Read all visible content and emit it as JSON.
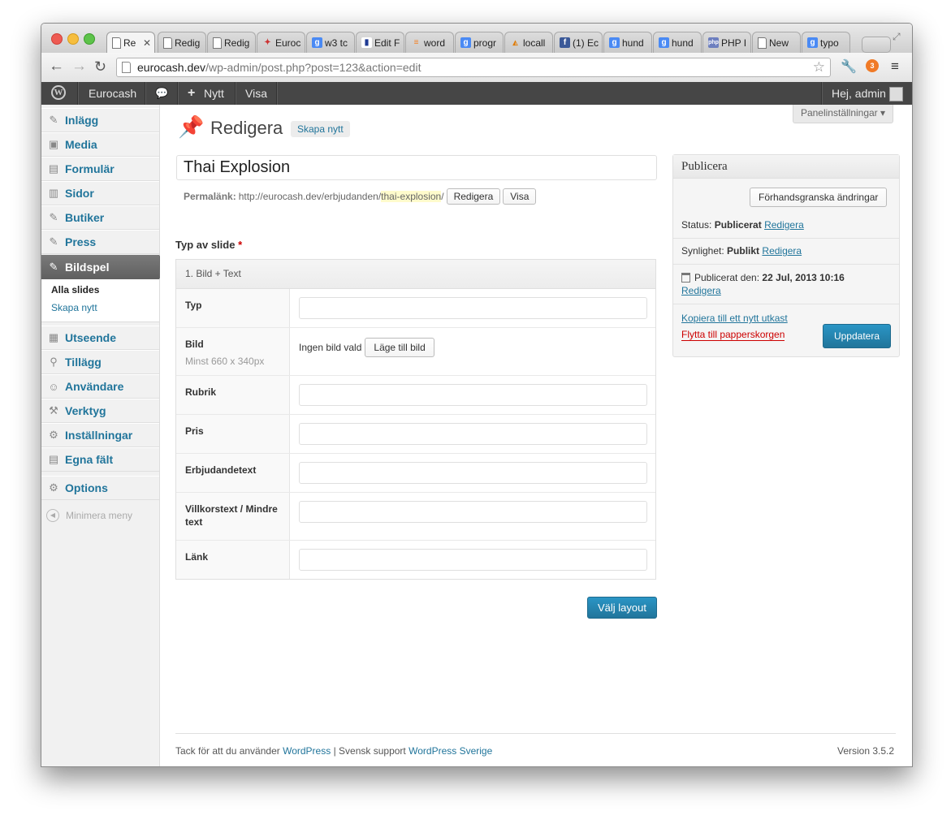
{
  "browser": {
    "tabs": [
      {
        "label": "Re",
        "icon": "document-icon",
        "active": true
      },
      {
        "label": "Redig",
        "icon": "document-icon"
      },
      {
        "label": "Redig",
        "icon": "document-icon"
      },
      {
        "label": "Euroc",
        "icon": "pin-icon"
      },
      {
        "label": "w3 tc",
        "icon": "google-icon"
      },
      {
        "label": "Edit F",
        "icon": "bar-chart-icon"
      },
      {
        "label": "word",
        "icon": "stack-icon"
      },
      {
        "label": "progr",
        "icon": "google-icon"
      },
      {
        "label": "locall",
        "icon": "phpmyadmin-icon"
      },
      {
        "label": "(1) Ec",
        "icon": "facebook-icon"
      },
      {
        "label": "hund",
        "icon": "google-icon"
      },
      {
        "label": "hund",
        "icon": "google-icon"
      },
      {
        "label": "PHP I",
        "icon": "php-icon"
      },
      {
        "label": "New",
        "icon": "document-icon"
      },
      {
        "label": "typo",
        "icon": "google-icon"
      }
    ],
    "url_host": "eurocash.dev",
    "url_path": "/wp-admin/post.php?post=123&action=edit"
  },
  "adminbar": {
    "site_name": "Eurocash",
    "new_label": "Nytt",
    "view_label": "Visa",
    "greeting": "Hej, admin"
  },
  "sidebar": {
    "items": [
      {
        "label": "Inlägg",
        "icon": "pin-icon"
      },
      {
        "label": "Media",
        "icon": "media-icon"
      },
      {
        "label": "Formulär",
        "icon": "form-icon"
      },
      {
        "label": "Sidor",
        "icon": "pages-icon"
      },
      {
        "label": "Butiker",
        "icon": "pin-icon"
      },
      {
        "label": "Press",
        "icon": "pin-icon"
      },
      {
        "label": "Bildspel",
        "icon": "pin-icon",
        "current": true
      }
    ],
    "submenu": {
      "current": "Alla slides",
      "link": "Skapa nytt"
    },
    "items2": [
      {
        "label": "Utseende",
        "icon": "appearance-icon"
      },
      {
        "label": "Tillägg",
        "icon": "plugins-icon"
      },
      {
        "label": "Användare",
        "icon": "users-icon"
      },
      {
        "label": "Verktyg",
        "icon": "tools-icon"
      },
      {
        "label": "Inställningar",
        "icon": "settings-icon"
      },
      {
        "label": "Egna fält",
        "icon": "custom-fields-icon"
      }
    ],
    "options": "Options",
    "collapse": "Minimera meny"
  },
  "main": {
    "screen_options": "Panelinställningar",
    "title": "Redigera",
    "add_new": "Skapa nytt",
    "post_title": "Thai Explosion",
    "permalink_label": "Permalänk:",
    "permalink_base": "http://eurocash.dev/erbjudanden/",
    "permalink_slug": "thai-explosion",
    "permalink_end": "/",
    "edit_btn": "Redigera",
    "view_btn": "Visa",
    "acf_label": "Typ av slide",
    "acf_required": "*",
    "layout_header": "1. Bild + Text",
    "fields": [
      {
        "label": "Typ"
      },
      {
        "label": "Bild",
        "hint": "Minst 660 x 340px",
        "no_image": "Ingen bild vald",
        "button": "Läge till bild"
      },
      {
        "label": "Rubrik"
      },
      {
        "label": "Pris"
      },
      {
        "label": "Erbjudandetext"
      },
      {
        "label": "Villkorstext / Mindre text"
      },
      {
        "label": "Länk"
      }
    ],
    "choose_layout": "Välj layout"
  },
  "publish": {
    "title": "Publicera",
    "preview_btn": "Förhandsgranska ändringar",
    "status_label": "Status:",
    "status_value": "Publicerat",
    "visibility_label": "Synlighet:",
    "visibility_value": "Publikt",
    "published_label": "Publicerat den:",
    "published_value": "22 Jul, 2013 10:16",
    "edit_link": "Redigera",
    "copy_link": "Kopiera till ett nytt utkast",
    "trash_link": "Flytta till papperskorgen",
    "update_btn": "Uppdatera"
  },
  "footer": {
    "thanks": "Tack för att du använder",
    "wordpress": "WordPress",
    "separator": "|",
    "support": "Svensk support",
    "wp_sverige": "WordPress Sverige",
    "version": "Version 3.5.2"
  }
}
